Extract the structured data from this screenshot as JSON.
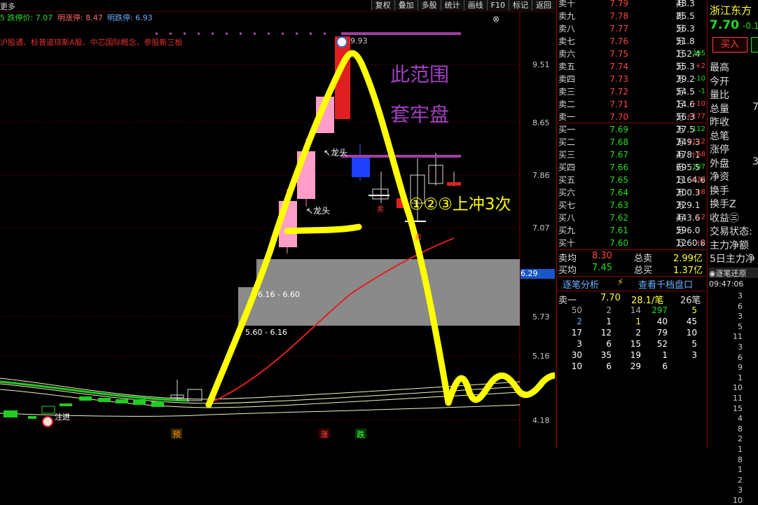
{
  "header": {
    "more": "更多",
    "limit_down": "5 跌停价: 7.07",
    "next_limit_up": "明涨停: 8.47",
    "next_limit_down": "明跌停: 6.93"
  },
  "toolbar": [
    "复权",
    "叠加",
    "多股",
    "统计",
    "画线",
    "F10",
    "标记",
    "返回"
  ],
  "concepts": "沪股通、标普道琼斯A股、中芯国际概念、参股新三板",
  "price_axis": [
    "9.51",
    "8.65",
    "7.86",
    "7.07",
    "6.29",
    "5.73",
    "5.16",
    "4.18"
  ],
  "annotations": {
    "peak_price": "9.93",
    "range_text_1": "此范围",
    "range_text_2": "套牢盘",
    "attempts": "①②③上冲3次",
    "dragon_1": "龙头",
    "dragon_2": "龙头",
    "zone_1": "6.16 - 6.60",
    "zone_2": "5.60 - 6.16",
    "marker_yu": "预",
    "marker_zhang": "涨",
    "marker_die": "跌",
    "enter": "注进",
    "sell_mark": "卖",
    "current_price_tag": "6.29"
  },
  "order_book": {
    "asks": [
      {
        "label": "卖十",
        "price": "7.79",
        "vol": "48.3",
        "unit": "万",
        "chg": ""
      },
      {
        "label": "卖九",
        "price": "7.78",
        "vol": "85.5",
        "unit": "万",
        "chg": ""
      },
      {
        "label": "卖八",
        "price": "7.77",
        "vol": "56.3",
        "unit": "万",
        "chg": ""
      },
      {
        "label": "卖七",
        "price": "7.76",
        "vol": "51.8",
        "unit": "万",
        "chg": ""
      },
      {
        "label": "卖六",
        "price": "7.75",
        "vol": "152.4",
        "unit": "万",
        "chg": "-295"
      },
      {
        "label": "卖五",
        "price": "7.74",
        "vol": "55.3",
        "unit": "万",
        "chg": "+2"
      },
      {
        "label": "卖四",
        "price": "7.73",
        "vol": "39.2",
        "unit": "万",
        "chg": "-10"
      },
      {
        "label": "卖三",
        "price": "7.72",
        "vol": "54.5",
        "unit": "万",
        "chg": "-1"
      },
      {
        "label": "卖二",
        "price": "7.71",
        "vol": "14.6",
        "unit": "万",
        "chg": "+10"
      },
      {
        "label": "卖一",
        "price": "7.70",
        "vol": "56.3",
        "unit": "万",
        "chg": "+177"
      }
    ],
    "bids": [
      {
        "label": "买一",
        "price": "7.69",
        "vol": "37.5",
        "unit": "万",
        "chg": "-112"
      },
      {
        "label": "买二",
        "price": "7.68",
        "vol": "349.3",
        "unit": "万",
        "chg": "+112"
      },
      {
        "label": "买三",
        "price": "7.67",
        "vol": "478.1",
        "unit": "万",
        "chg": "+68"
      },
      {
        "label": "买四",
        "price": "7.66",
        "vol": "695.5",
        "unit": "万",
        "chg": "-107"
      },
      {
        "label": "买五",
        "price": "7.65",
        "vol": "1164.6",
        "unit": "万",
        "chg": "+32"
      },
      {
        "label": "买六",
        "price": "7.64",
        "vol": "300.3",
        "unit": "万",
        "chg": "+8"
      },
      {
        "label": "买七",
        "price": "7.63",
        "vol": "329.1",
        "unit": "万",
        "chg": ""
      },
      {
        "label": "买八",
        "price": "7.62",
        "vol": "443.6",
        "unit": "万",
        "chg": "+2"
      },
      {
        "label": "买九",
        "price": "7.61",
        "vol": "596.0",
        "unit": "万",
        "chg": ""
      },
      {
        "label": "买十",
        "price": "7.60",
        "vol": "1260.8",
        "unit": "万",
        "chg": "+2"
      }
    ],
    "summary": {
      "ask_avg_label": "卖均",
      "ask_avg": "8.30",
      "total_sell_label": "总卖",
      "total_sell": "2.99",
      "total_sell_unit": "亿",
      "bid_avg_label": "买均",
      "bid_avg": "7.45",
      "total_buy_label": "总买",
      "total_buy": "1.37",
      "total_buy_unit": "亿"
    },
    "tabs": {
      "tick_analysis": "逐笔分析",
      "view_depth": "查看千档盘口"
    },
    "ask1_stat": {
      "label": "卖一",
      "price": "7.70",
      "per": "28.1/笔",
      "count": "26笔"
    },
    "tick_grid": [
      [
        "50",
        "2",
        "14",
        "297",
        "5"
      ],
      [
        "2",
        "1",
        "1",
        "40",
        "45"
      ],
      [
        "17",
        "12",
        "2",
        "79",
        "10"
      ],
      [
        "3",
        "6",
        "15",
        "52",
        "5"
      ],
      [
        "30",
        "35",
        "19",
        "1",
        "3"
      ],
      [
        "10",
        "6",
        "29",
        "6",
        ""
      ]
    ]
  },
  "side_panel": {
    "stock_name": "浙江东方",
    "price": "7.70",
    "change": "-0.1",
    "buy_button": "买入",
    "labels": [
      "最高",
      "今开",
      "量比",
      "总量",
      "昨收",
      "总笔",
      "涨停",
      "外盘",
      "净资",
      "换手",
      "换手Z",
      "收益㊂",
      "交易状态:",
      "主力净额",
      "5日主力净"
    ],
    "values": {
      "总量": "7",
      "外盘": "3"
    },
    "tick_replay": "逐笔还原",
    "time": "09:47:06",
    "tick_numbers": [
      "3",
      "6",
      "3",
      "5",
      "11",
      "3",
      "6",
      "9",
      "1",
      "10",
      "11",
      "15",
      "4",
      "8",
      "2",
      "1",
      "8",
      "1",
      "2",
      "3",
      "10"
    ]
  }
}
